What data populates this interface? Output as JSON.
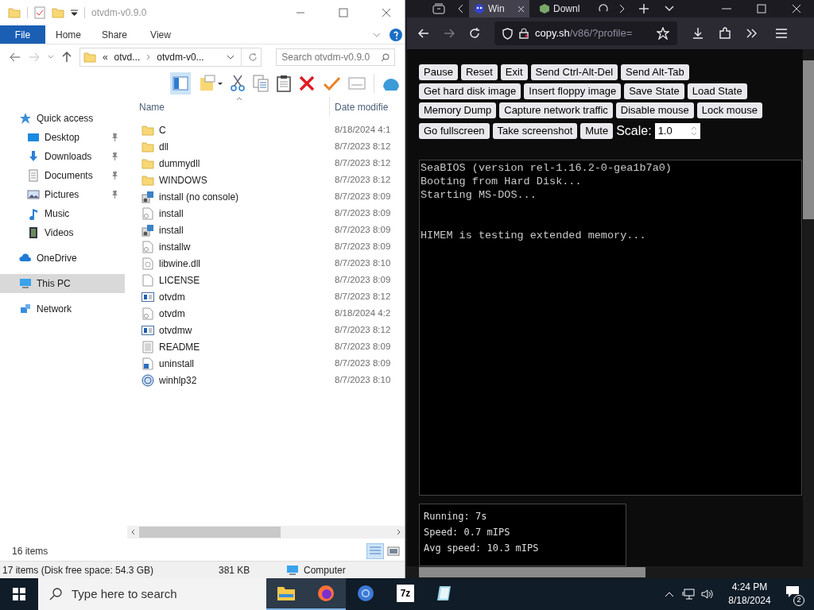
{
  "explorer": {
    "title": "otvdm-v0.9.0",
    "ribbon_tabs": [
      {
        "label": "File",
        "selected": true
      },
      {
        "label": "Home",
        "selected": false
      },
      {
        "label": "Share",
        "selected": false
      },
      {
        "label": "View",
        "selected": false
      }
    ],
    "address": {
      "overflow": "«",
      "crumbs": [
        "otvd...",
        "otvdm-v0..."
      ]
    },
    "search": {
      "placeholder": "Search otvdm-v0.9.0"
    },
    "nav": [
      {
        "label": "Quick access",
        "kind": "star",
        "selected": false,
        "children": [
          {
            "label": "Desktop",
            "kind": "desktop",
            "pinned": true,
            "selected": false
          },
          {
            "label": "Downloads",
            "kind": "download",
            "pinned": true,
            "selected": false
          },
          {
            "label": "Documents",
            "kind": "document",
            "pinned": true,
            "selected": false
          },
          {
            "label": "Pictures",
            "kind": "pictures",
            "pinned": true,
            "selected": false
          },
          {
            "label": "Music",
            "kind": "music",
            "pinned": false,
            "selected": false
          },
          {
            "label": "Videos",
            "kind": "videos",
            "pinned": false,
            "selected": false
          }
        ]
      },
      {
        "label": "OneDrive",
        "kind": "cloud",
        "selected": false
      },
      {
        "label": "This PC",
        "kind": "pc",
        "selected": true
      },
      {
        "label": "Network",
        "kind": "network",
        "selected": false
      }
    ],
    "columns": [
      "Name",
      "Date modifie"
    ],
    "rows": [
      {
        "name": "C",
        "date": "8/18/2024 4:1",
        "kind": "folder"
      },
      {
        "name": "dll",
        "date": "8/7/2023 8:12",
        "kind": "folder"
      },
      {
        "name": "dummydll",
        "date": "8/7/2023 8:12",
        "kind": "folder"
      },
      {
        "name": "WINDOWS",
        "date": "8/7/2023 8:12",
        "kind": "folder"
      },
      {
        "name": "install (no console)",
        "date": "8/7/2023 8:09",
        "kind": "setup"
      },
      {
        "name": "install",
        "date": "8/7/2023 8:09",
        "kind": "settings"
      },
      {
        "name": "install",
        "date": "8/7/2023 8:09",
        "kind": "setup"
      },
      {
        "name": "installw",
        "date": "8/7/2023 8:09",
        "kind": "settings"
      },
      {
        "name": "libwine.dll",
        "date": "8/7/2023 8:10",
        "kind": "dll"
      },
      {
        "name": "LICENSE",
        "date": "8/7/2023 8:09",
        "kind": "blank"
      },
      {
        "name": "otvdm",
        "date": "8/7/2023 8:12",
        "kind": "app"
      },
      {
        "name": "otvdm",
        "date": "8/18/2024 4:2",
        "kind": "settings"
      },
      {
        "name": "otvdmw",
        "date": "8/7/2023 8:12",
        "kind": "app"
      },
      {
        "name": "README",
        "date": "8/7/2023 8:09",
        "kind": "text"
      },
      {
        "name": "uninstall",
        "date": "8/7/2023 8:09",
        "kind": "uninstall"
      },
      {
        "name": "winhlp32",
        "date": "8/7/2023 8:10",
        "kind": "help"
      }
    ],
    "item_count": "16 items",
    "status_bar": [
      "17 items (Disk free space: 54.3 GB)",
      "381 KB",
      "Computer"
    ]
  },
  "browser": {
    "tabs": [
      {
        "label": "Win",
        "selected": true
      },
      {
        "label": "Downl",
        "selected": false
      }
    ],
    "url_host": "copy.sh",
    "url_rest": "/v86/?profile=",
    "button_rows": [
      [
        "Pause",
        "Reset",
        "Exit",
        "Send Ctrl-Alt-Del",
        "Send Alt-Tab"
      ],
      [
        "Get hard disk image",
        "Insert floppy image",
        "Save State",
        "Load State"
      ],
      [
        "Memory Dump",
        "Capture network traffic",
        "Disable mouse",
        "Lock mouse"
      ],
      [
        "Go fullscreen",
        "Take screenshot",
        "Mute"
      ]
    ],
    "scale_label": "Scale:",
    "scale_value": "1.0",
    "screen_blocks": [
      [
        "SeaBIOS (version rel-1.16.2-0-gea1b7a0)",
        "Booting from Hard Disk...",
        "Starting MS-DOS..."
      ],
      [
        "HIMEM is testing extended memory..."
      ]
    ],
    "stats": [
      "Running: 7s",
      "Speed: 0.7 mIPS",
      "Avg speed: 10.3 mIPS"
    ]
  },
  "taskbar": {
    "search_placeholder": "Type here to search",
    "apps": [
      {
        "kind": "explorer",
        "active": true
      },
      {
        "kind": "firefox",
        "active": true
      },
      {
        "kind": "chrome",
        "active": false
      },
      {
        "kind": "archiver",
        "label": "7z",
        "active": false
      },
      {
        "kind": "notepad",
        "active": false
      }
    ],
    "time": "4:24 PM",
    "date": "8/18/2024",
    "notifications": "2"
  }
}
